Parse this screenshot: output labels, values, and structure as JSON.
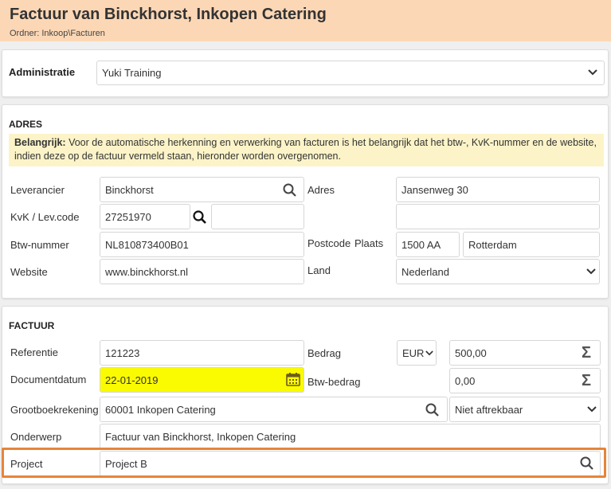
{
  "header": {
    "title": "Factuur van Binckhorst, Inkopen Catering",
    "folder": "Ordner: Inkoop\\Facturen"
  },
  "administratie": {
    "label": "Administratie",
    "value": "Yuki Training"
  },
  "adres": {
    "section_title": "ADRES",
    "notice_bold": "Belangrijk:",
    "notice_text": " Voor de automatische herkenning en verwerking van facturen is het belangrijk dat het btw-, KvK-nummer en de website, indien deze op de factuur vermeld staan, hieronder worden overgenomen.",
    "leverancier_label": "Leverancier",
    "leverancier_value": "Binckhorst",
    "kvk_label": "KvK / Lev.code",
    "kvk_value": "27251970",
    "levcode_value": "",
    "btw_label": "Btw-nummer",
    "btw_value": "NL810873400B01",
    "website_label": "Website",
    "website_value": "www.binckhorst.nl",
    "adres_label": "Adres",
    "adres_value": "Jansenweg 30",
    "adres2_value": "",
    "postcode_label": "Postcode",
    "plaats_label": "Plaats",
    "postcode_value": "1500 AA",
    "plaats_value": "Rotterdam",
    "land_label": "Land",
    "land_value": "Nederland"
  },
  "factuur": {
    "section_title": "FACTUUR",
    "referentie_label": "Referentie",
    "referentie_value": "121223",
    "documentdatum_label": "Documentdatum",
    "documentdatum_value": "22-01-2019",
    "grootboek_label": "Grootboekrekening",
    "grootboek_value": "60001 Inkopen Catering",
    "aftrek_value": "Niet aftrekbaar",
    "onderwerp_label": "Onderwerp",
    "onderwerp_value": "Factuur van  Binckhorst, Inkopen Catering",
    "project_label": "Project",
    "project_value": "Project B",
    "bedrag_label": "Bedrag",
    "currency_value": "EUR",
    "bedrag_value": "500,00",
    "btwbedrag_label": "Btw-bedrag",
    "btwbedrag_value": "0,00"
  },
  "colors": {
    "header_bg": "#fcd7b5",
    "notice_bg": "#fcf4c8",
    "date_highlight": "#fafa00",
    "project_outline": "#e6853a"
  }
}
